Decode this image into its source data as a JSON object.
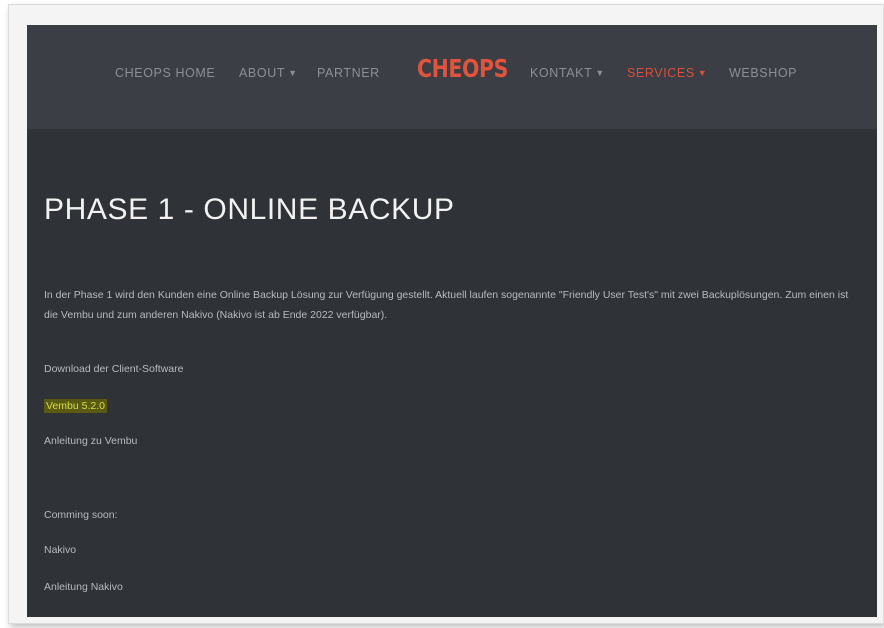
{
  "nav": {
    "home": "CHEOPS HOME",
    "about": "ABOUT",
    "partner": "PARTNER",
    "logo": "CHEOPS",
    "kontakt": "KONTAKT",
    "services": "SERVICES",
    "webshop": "WEBSHOP",
    "active_color": "#d9503a"
  },
  "main": {
    "title": "PHASE 1 - ONLINE BACKUP",
    "intro": "In der Phase 1 wird den Kunden eine Online Backup Lösung zur Verfügung gestellt. Aktuell laufen sogenannte \"Friendly User Test's\" mit zwei Backuplösungen. Zum einen ist die Vembu und zum anderen Nakivo (Nakivo ist ab Ende 2022 verfügbar).",
    "download_label": "Download der Client-Software",
    "vembu_link": "Vembu 5.2.0",
    "vembu_guide": "Anleitung zu Vembu",
    "coming_soon": "Comming soon:",
    "nakivo_link": "Nakivo",
    "nakivo_guide": "Anleitung Nakivo"
  }
}
